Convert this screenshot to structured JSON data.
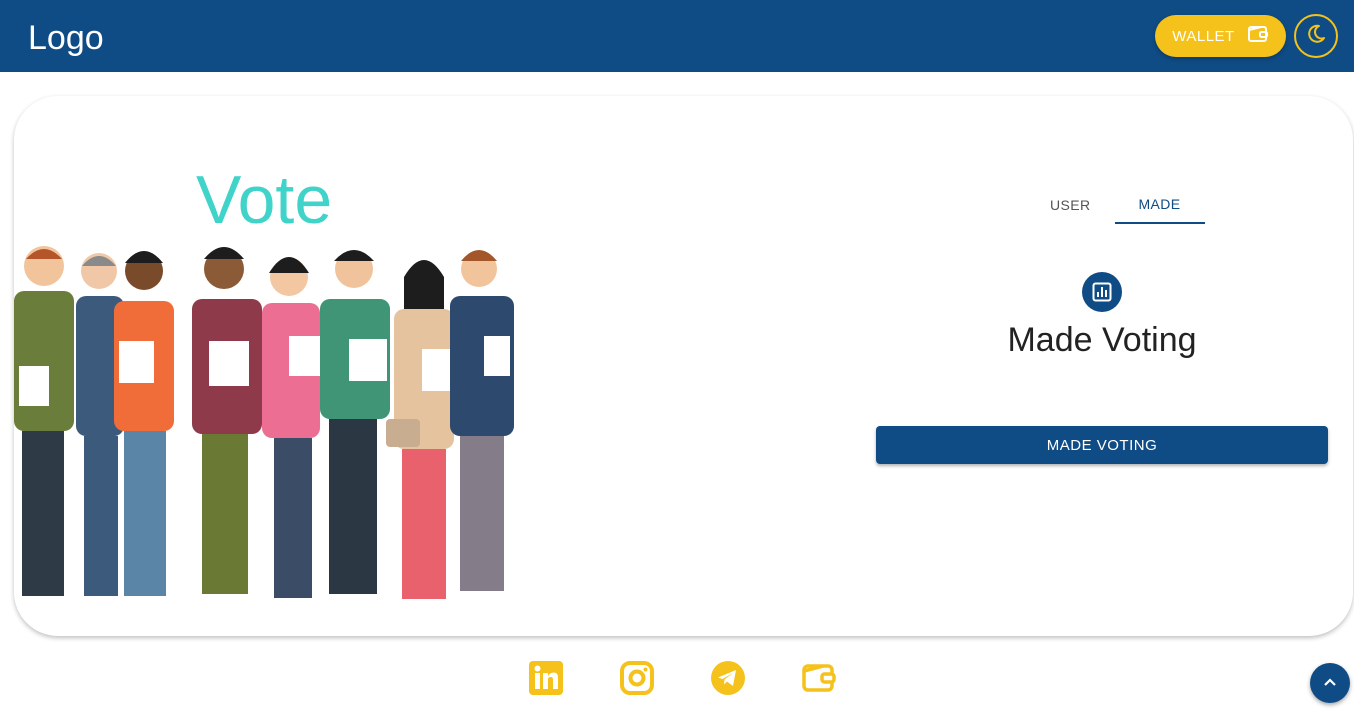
{
  "header": {
    "logo": "Logo",
    "wallet_label": "WALLET",
    "wallet_icon": "wallet-icon",
    "theme_icon": "moon-icon"
  },
  "hero": {
    "title": "Vote",
    "illustration": "people-holding-papers-illustration"
  },
  "tabs": [
    {
      "label": "USER",
      "active": false
    },
    {
      "label": "MADE",
      "active": true
    }
  ],
  "panel": {
    "icon": "poll-chart-icon",
    "title": "Made Voting",
    "button_label": "MADE VOTING"
  },
  "footer": {
    "social_icons": [
      "linkedin-icon",
      "instagram-icon",
      "telegram-icon",
      "wallet-icon"
    ],
    "scroll_top_icon": "chevron-up-icon"
  },
  "colors": {
    "primary": "#0f4c85",
    "accent": "#f5c21b",
    "title": "#3fd3c9"
  }
}
